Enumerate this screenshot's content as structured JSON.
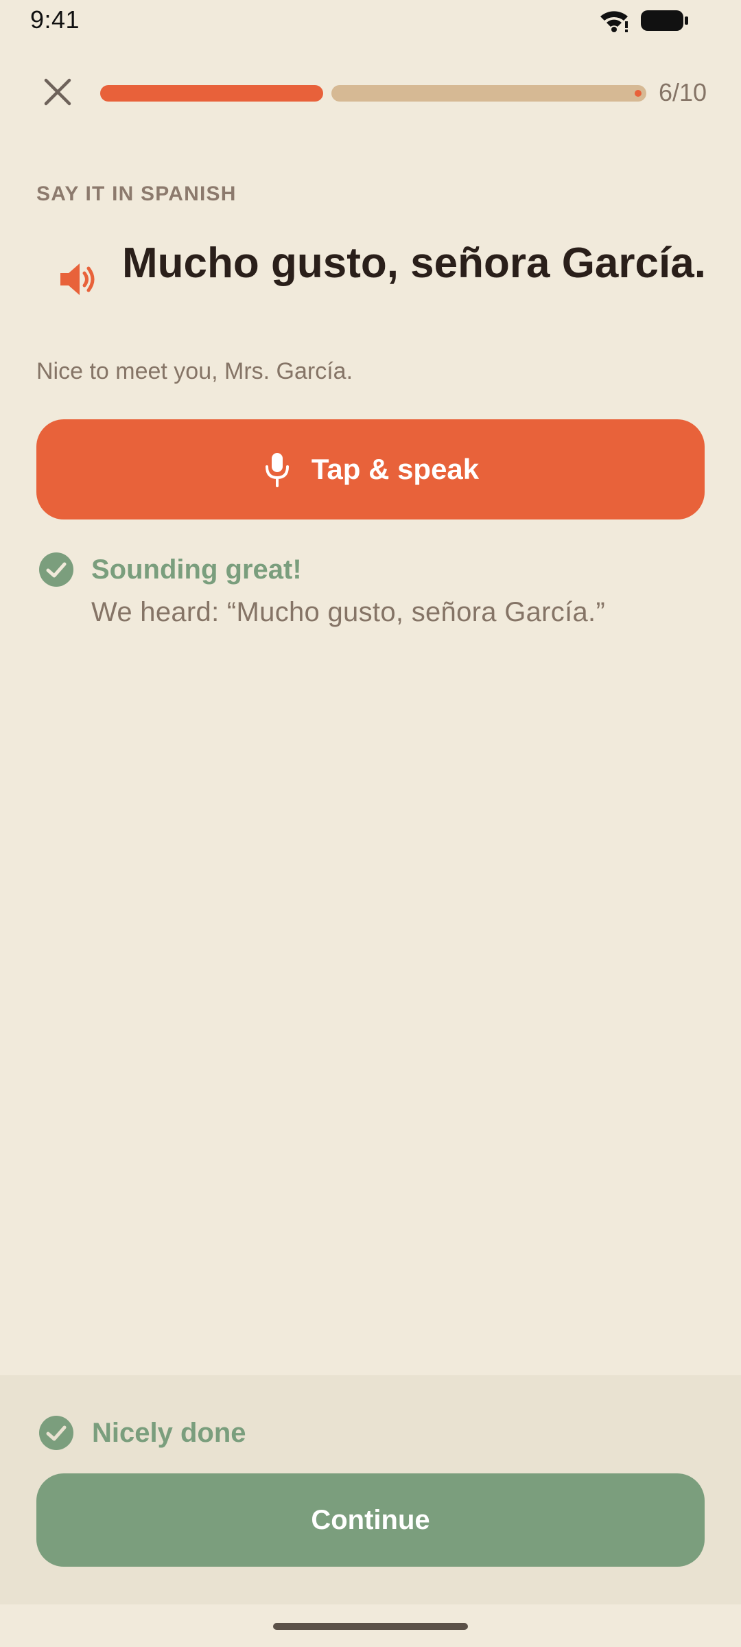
{
  "status_bar": {
    "time": "9:41"
  },
  "header": {
    "close_icon": "close-icon",
    "progress": {
      "current": 6,
      "total": 10,
      "label": "6/10"
    }
  },
  "prompt": {
    "instruction": "SAY IT IN SPANISH",
    "speaker_icon": "speaker-icon",
    "phrase": "Mucho gusto, señora García.",
    "translation": "Nice to meet you, Mrs. García."
  },
  "speak_button": {
    "icon": "microphone-icon",
    "label": "Tap & speak"
  },
  "feedback": {
    "icon": "check-circle-icon",
    "title": "Sounding great!",
    "heard": "We heard: “Mucho gusto, señora García.”"
  },
  "bottom_sheet": {
    "icon": "check-circle-icon",
    "status": "Nicely done",
    "continue_label": "Continue"
  },
  "colors": {
    "background": "#f1eadb",
    "accent": "#e8623a",
    "success": "#7b9e7d",
    "progress_rest": "#d6b994",
    "muted_text": "#857466",
    "sheet": "#e9e2d1"
  }
}
